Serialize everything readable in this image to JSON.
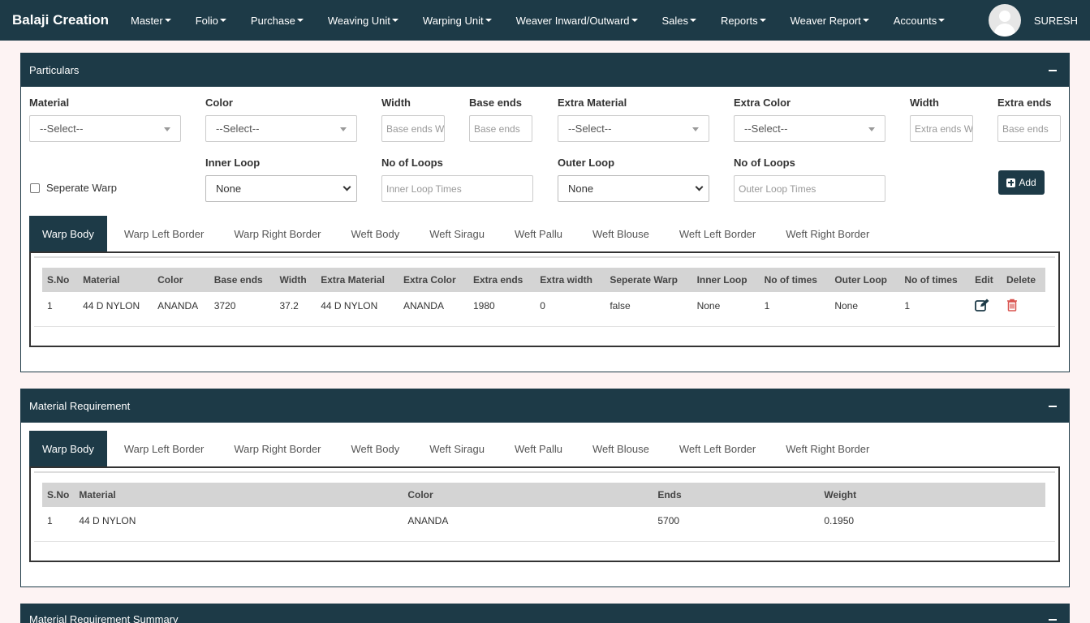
{
  "nav": {
    "brand": "Balaji Creation",
    "menu": [
      "Master",
      "Folio",
      "Purchase",
      "Weaving Unit",
      "Warping Unit",
      "Weaver Inward/Outward",
      "Sales",
      "Reports",
      "Weaver Report",
      "Accounts"
    ],
    "user": "SURESH"
  },
  "particulars": {
    "title": "Particulars",
    "material_label": "Material",
    "material_value": "--Select--",
    "color_label": "Color",
    "color_value": "--Select--",
    "width_label": "Width",
    "width_placeholder": "Base ends W",
    "base_ends_label": "Base ends",
    "base_ends_placeholder": "Base ends",
    "extra_material_label": "Extra Material",
    "extra_material_value": "--Select--",
    "extra_color_label": "Extra Color",
    "extra_color_value": "--Select--",
    "extra_width_label": "Width",
    "extra_width_placeholder": "Extra ends W",
    "extra_ends_label": "Extra ends",
    "extra_ends_placeholder": "Base ends",
    "separate_warp_label": "Seperate Warp",
    "inner_loop_label": "Inner Loop",
    "inner_loop_value": "None",
    "inner_no_loops_label": "No of Loops",
    "inner_no_loops_placeholder": "Inner Loop Times",
    "outer_loop_label": "Outer Loop",
    "outer_loop_value": "None",
    "outer_no_loops_label": "No of Loops",
    "outer_no_loops_placeholder": "Outer Loop Times",
    "add_label": "Add",
    "tabs": [
      "Warp Body",
      "Warp Left Border",
      "Warp Right Border",
      "Weft Body",
      "Weft Siragu",
      "Weft Pallu",
      "Weft Blouse",
      "Weft Left Border",
      "Weft Right Border"
    ],
    "table": {
      "headers": [
        "S.No",
        "Material",
        "Color",
        "Base ends",
        "Width",
        "Extra Material",
        "Extra Color",
        "Extra ends",
        "Extra width",
        "Seperate Warp",
        "Inner Loop",
        "No of times",
        "Outer Loop",
        "No of times",
        "Edit",
        "Delete"
      ],
      "rows": [
        [
          "1",
          "44 D NYLON",
          "ANANDA",
          "3720",
          "37.2",
          "44 D NYLON",
          "ANANDA",
          "1980",
          "0",
          "false",
          "None",
          "1",
          "None",
          "1"
        ]
      ]
    }
  },
  "material_requirement": {
    "title": "Material Requirement",
    "tabs": [
      "Warp Body",
      "Warp Left Border",
      "Warp Right Border",
      "Weft Body",
      "Weft Siragu",
      "Weft Pallu",
      "Weft Blouse",
      "Weft Left Border",
      "Weft Right Border"
    ],
    "table": {
      "headers": [
        "S.No",
        "Material",
        "Color",
        "Ends",
        "Weight"
      ],
      "rows": [
        [
          "1",
          "44 D NYLON",
          "ANANDA",
          "5700",
          "0.1950"
        ]
      ]
    }
  },
  "summary": {
    "title": "Material Requirement Summary"
  },
  "colors": {
    "primary": "#1d3a47",
    "edit": "#1d3a47",
    "delete": "#d9534f"
  }
}
